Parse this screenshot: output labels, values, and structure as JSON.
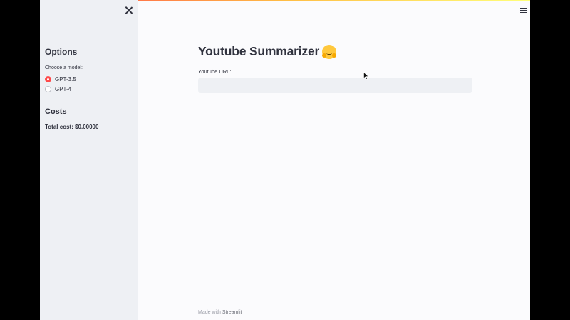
{
  "sidebar": {
    "options_heading": "Options",
    "model_label": "Choose a model:",
    "models": [
      {
        "label": "GPT-3.5",
        "selected": true
      },
      {
        "label": "GPT-4",
        "selected": false
      }
    ],
    "costs_heading": "Costs",
    "total_cost": "Total cost: $0.00000"
  },
  "main": {
    "title": "Youtube Summarizer",
    "title_emoji": "hugging-face-emoji",
    "url_label": "Youtube URL:",
    "url_value": "",
    "url_placeholder": ""
  },
  "footer": {
    "prefix": "Made with",
    "brand": "Streamlit"
  },
  "colors": {
    "accent": "#ff4b4b",
    "sidebar_bg": "#eef0f4",
    "main_bg": "#fbfbfd",
    "text": "#31333f"
  }
}
